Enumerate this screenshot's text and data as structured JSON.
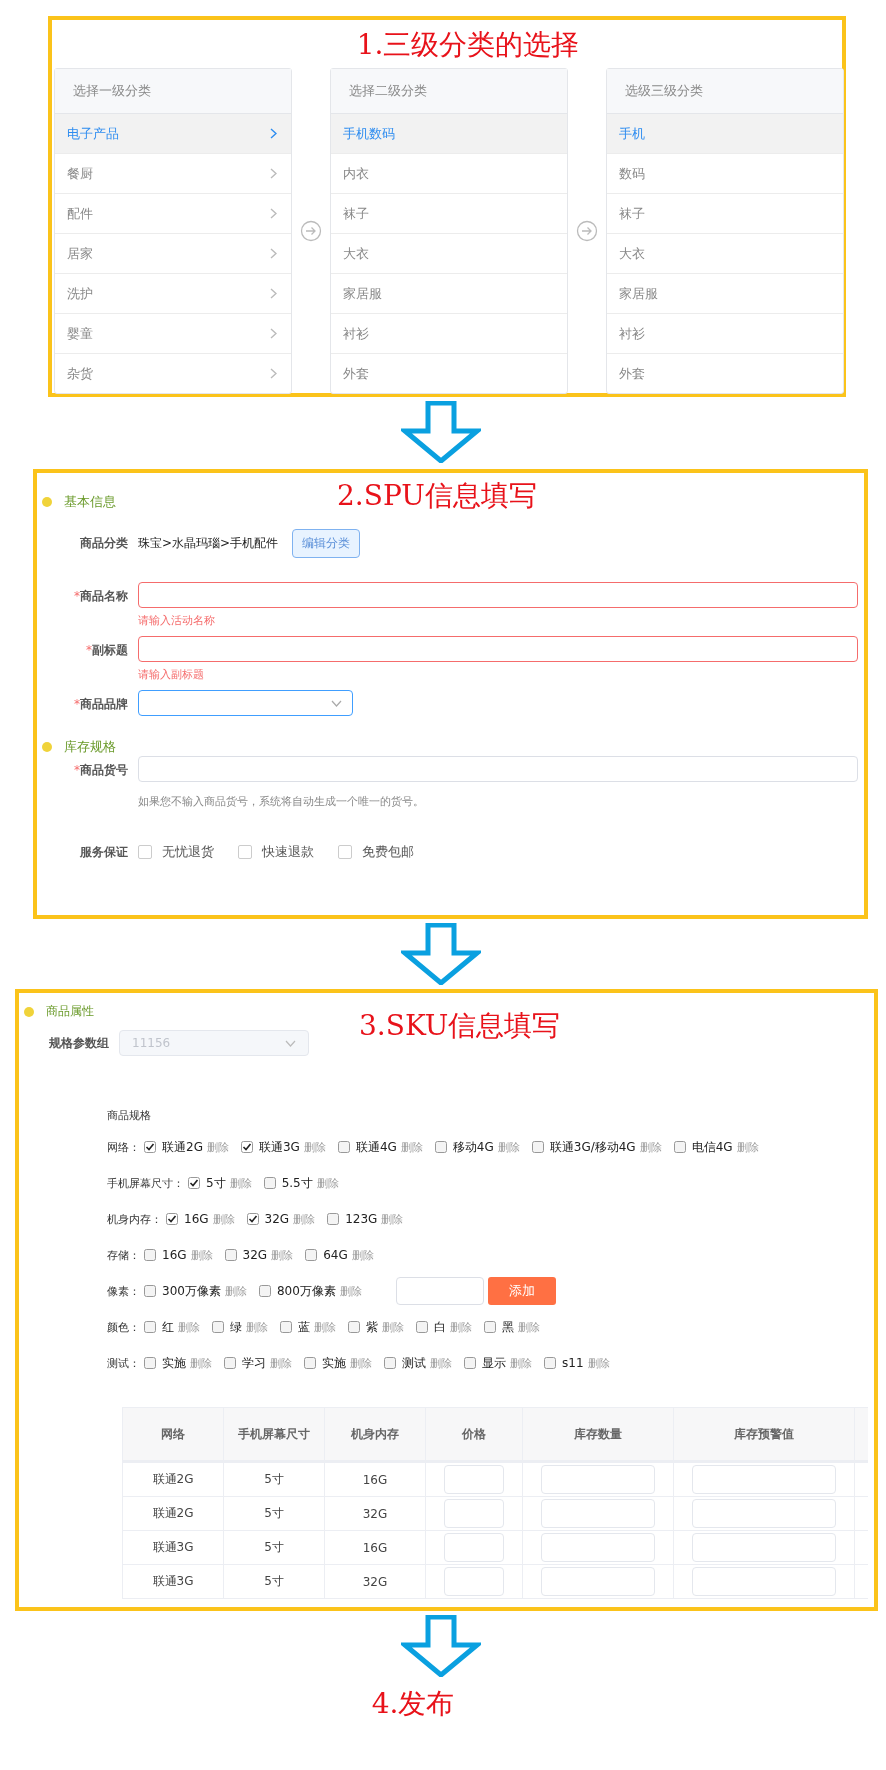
{
  "step1": {
    "title": "1.三级分类的选择",
    "columns": [
      {
        "header": "选择一级分类",
        "kind": "parent",
        "items": [
          {
            "label": "电子产品",
            "selected": true
          },
          {
            "label": "餐厨",
            "selected": false
          },
          {
            "label": "配件",
            "selected": false
          },
          {
            "label": "居家",
            "selected": false
          },
          {
            "label": "洗护",
            "selected": false
          },
          {
            "label": "婴童",
            "selected": false
          },
          {
            "label": "杂货",
            "selected": false
          }
        ]
      },
      {
        "header": "选择二级分类",
        "kind": "leaf",
        "items": [
          {
            "label": "手机数码",
            "selected": true
          },
          {
            "label": "内衣",
            "selected": false
          },
          {
            "label": "袜子",
            "selected": false
          },
          {
            "label": "大衣",
            "selected": false
          },
          {
            "label": "家居服",
            "selected": false
          },
          {
            "label": "衬衫",
            "selected": false
          },
          {
            "label": "外套",
            "selected": false
          }
        ]
      },
      {
        "header": "选级三级分类",
        "kind": "leaf",
        "items": [
          {
            "label": "手机",
            "selected": true
          },
          {
            "label": "数码",
            "selected": false
          },
          {
            "label": "袜子",
            "selected": false
          },
          {
            "label": "大衣",
            "selected": false
          },
          {
            "label": "家居服",
            "selected": false
          },
          {
            "label": "衬衫",
            "selected": false
          },
          {
            "label": "外套",
            "selected": false
          }
        ]
      }
    ]
  },
  "step2": {
    "title": "2.SPU信息填写",
    "basic_heading": "基本信息",
    "category": {
      "label": "商品分类",
      "path": "珠宝>水晶玛瑙>手机配件",
      "button": "编辑分类"
    },
    "fields": [
      {
        "label": "商品名称",
        "required_mark": "*",
        "kind": "text",
        "error": "请输入活动名称",
        "focused": false
      },
      {
        "label": "副标题",
        "required_mark": "*",
        "kind": "text",
        "error": "请输入副标题",
        "focused": false
      },
      {
        "label": "商品品牌",
        "required_mark": "*",
        "kind": "select",
        "focused": true
      }
    ],
    "stock_heading": "库存规格",
    "sku_field": {
      "label": "商品货号",
      "required_mark": "*",
      "hint": "如果您不输入商品货号，系统将自动生成一个唯一的货号。"
    },
    "service": {
      "label": "服务保证",
      "options": [
        {
          "label": "无忧退货",
          "checked": false
        },
        {
          "label": "快速退款",
          "checked": false
        },
        {
          "label": "免费包邮",
          "checked": false
        }
      ]
    }
  },
  "step3": {
    "title": "3.SKU信息填写",
    "heading": "商品属性",
    "param_group": {
      "label": "规格参数组",
      "value": "11156",
      "disabled": true
    },
    "spec_title": "商品规格",
    "spec_rows": [
      {
        "label": "网络：",
        "options": [
          {
            "label": "联通2G",
            "checked": true,
            "action": "删除"
          },
          {
            "label": "联通3G",
            "checked": true,
            "action": "删除"
          },
          {
            "label": "联通4G",
            "checked": false,
            "action": "删除"
          },
          {
            "label": "移动4G",
            "checked": false,
            "action": "删除"
          },
          {
            "label": "联通3G/移动4G",
            "checked": false,
            "action": "删除"
          },
          {
            "label": "电信4G",
            "checked": false,
            "action": "删除"
          }
        ]
      },
      {
        "label": "手机屏幕尺寸：",
        "options": [
          {
            "label": "5寸",
            "checked": true,
            "action": "删除"
          },
          {
            "label": "5.5寸",
            "checked": false,
            "action": "删除"
          }
        ]
      },
      {
        "label": "机身内存：",
        "options": [
          {
            "label": "16G",
            "checked": true,
            "action": "删除"
          },
          {
            "label": "32G",
            "checked": true,
            "action": "删除"
          },
          {
            "label": "123G",
            "checked": false,
            "action": "删除"
          }
        ]
      },
      {
        "label": "存储：",
        "options": [
          {
            "label": "16G",
            "checked": false,
            "action": "删除"
          },
          {
            "label": "32G",
            "checked": false,
            "action": "删除"
          },
          {
            "label": "64G",
            "checked": false,
            "action": "删除"
          }
        ]
      },
      {
        "label": "像素：",
        "options": [
          {
            "label": "300万像素",
            "checked": false,
            "action": "删除"
          },
          {
            "label": "800万像素",
            "checked": false,
            "action": "删除"
          }
        ],
        "add_button": "添加"
      },
      {
        "label": "颜色：",
        "options": [
          {
            "label": "红",
            "checked": false,
            "action": "删除"
          },
          {
            "label": "绿",
            "checked": false,
            "action": "删除"
          },
          {
            "label": "蓝",
            "checked": false,
            "action": "删除"
          },
          {
            "label": "紫",
            "checked": false,
            "action": "删除"
          },
          {
            "label": "白",
            "checked": false,
            "action": "删除"
          },
          {
            "label": "黑",
            "checked": false,
            "action": "删除"
          }
        ]
      },
      {
        "label": "测试：",
        "options": [
          {
            "label": "实施",
            "checked": false,
            "action": "删除"
          },
          {
            "label": "学习",
            "checked": false,
            "action": "删除"
          },
          {
            "label": "实施",
            "checked": false,
            "action": "删除"
          },
          {
            "label": "测试",
            "checked": false,
            "action": "删除"
          },
          {
            "label": "显示",
            "checked": false,
            "action": "删除"
          },
          {
            "label": "s11",
            "checked": false,
            "action": "删除"
          }
        ]
      }
    ],
    "table": {
      "columns": [
        {
          "label": "网络",
          "kind": "text"
        },
        {
          "label": "手机屏幕尺寸",
          "kind": "text"
        },
        {
          "label": "机身内存",
          "kind": "text"
        },
        {
          "label": "价格",
          "kind": "input"
        },
        {
          "label": "库存数量",
          "kind": "input"
        },
        {
          "label": "库存预警值",
          "kind": "input"
        }
      ],
      "rows": [
        [
          "联通2G",
          "5寸",
          "16G"
        ],
        [
          "联通2G",
          "5寸",
          "32G"
        ],
        [
          "联通3G",
          "5寸",
          "16G"
        ],
        [
          "联通3G",
          "5寸",
          "32G"
        ]
      ]
    }
  },
  "step4": {
    "title": "4.发布"
  }
}
